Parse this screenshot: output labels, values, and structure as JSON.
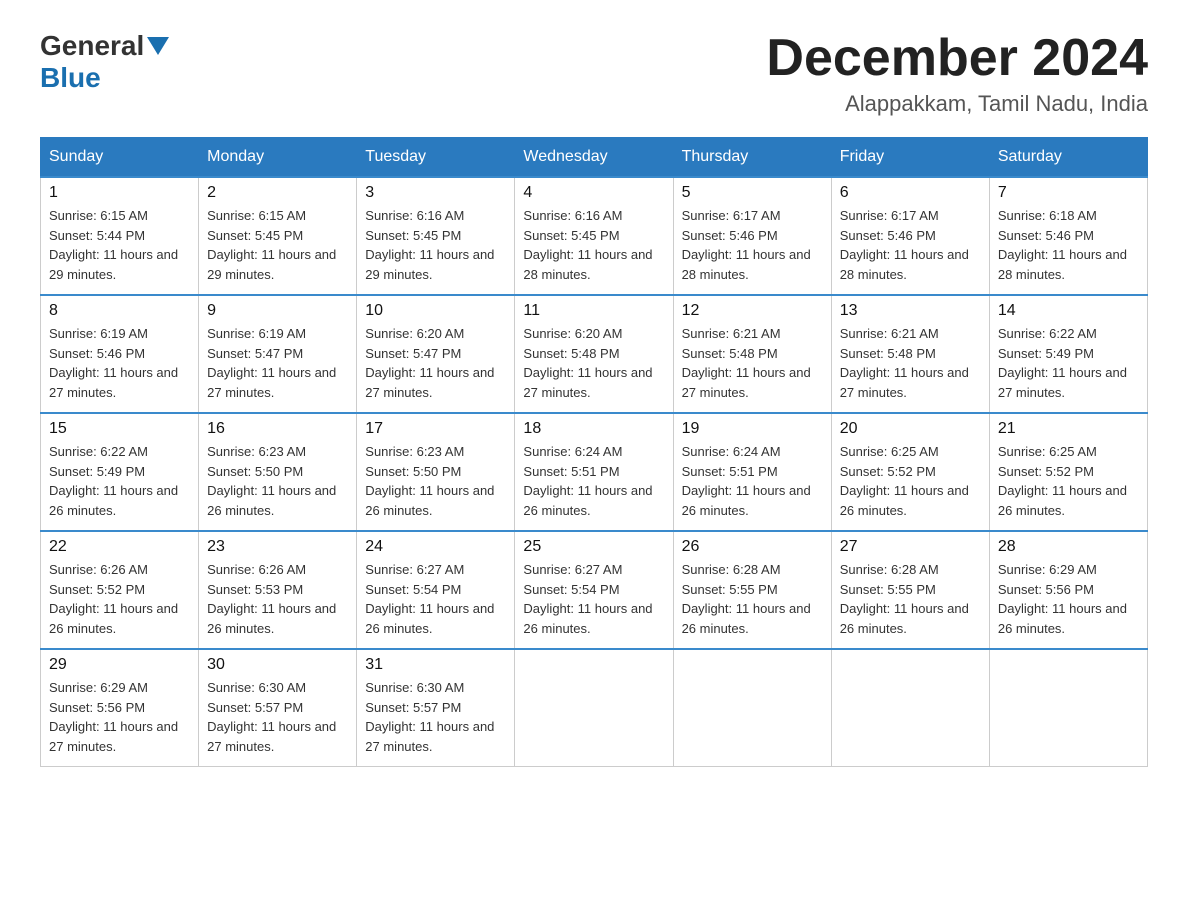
{
  "logo": {
    "general": "General",
    "blue": "Blue"
  },
  "title": "December 2024",
  "location": "Alappakkam, Tamil Nadu, India",
  "headers": [
    "Sunday",
    "Monday",
    "Tuesday",
    "Wednesday",
    "Thursday",
    "Friday",
    "Saturday"
  ],
  "weeks": [
    [
      {
        "day": "1",
        "sunrise": "6:15 AM",
        "sunset": "5:44 PM",
        "daylight": "11 hours and 29 minutes."
      },
      {
        "day": "2",
        "sunrise": "6:15 AM",
        "sunset": "5:45 PM",
        "daylight": "11 hours and 29 minutes."
      },
      {
        "day": "3",
        "sunrise": "6:16 AM",
        "sunset": "5:45 PM",
        "daylight": "11 hours and 29 minutes."
      },
      {
        "day": "4",
        "sunrise": "6:16 AM",
        "sunset": "5:45 PM",
        "daylight": "11 hours and 28 minutes."
      },
      {
        "day": "5",
        "sunrise": "6:17 AM",
        "sunset": "5:46 PM",
        "daylight": "11 hours and 28 minutes."
      },
      {
        "day": "6",
        "sunrise": "6:17 AM",
        "sunset": "5:46 PM",
        "daylight": "11 hours and 28 minutes."
      },
      {
        "day": "7",
        "sunrise": "6:18 AM",
        "sunset": "5:46 PM",
        "daylight": "11 hours and 28 minutes."
      }
    ],
    [
      {
        "day": "8",
        "sunrise": "6:19 AM",
        "sunset": "5:46 PM",
        "daylight": "11 hours and 27 minutes."
      },
      {
        "day": "9",
        "sunrise": "6:19 AM",
        "sunset": "5:47 PM",
        "daylight": "11 hours and 27 minutes."
      },
      {
        "day": "10",
        "sunrise": "6:20 AM",
        "sunset": "5:47 PM",
        "daylight": "11 hours and 27 minutes."
      },
      {
        "day": "11",
        "sunrise": "6:20 AM",
        "sunset": "5:48 PM",
        "daylight": "11 hours and 27 minutes."
      },
      {
        "day": "12",
        "sunrise": "6:21 AM",
        "sunset": "5:48 PM",
        "daylight": "11 hours and 27 minutes."
      },
      {
        "day": "13",
        "sunrise": "6:21 AM",
        "sunset": "5:48 PM",
        "daylight": "11 hours and 27 minutes."
      },
      {
        "day": "14",
        "sunrise": "6:22 AM",
        "sunset": "5:49 PM",
        "daylight": "11 hours and 27 minutes."
      }
    ],
    [
      {
        "day": "15",
        "sunrise": "6:22 AM",
        "sunset": "5:49 PM",
        "daylight": "11 hours and 26 minutes."
      },
      {
        "day": "16",
        "sunrise": "6:23 AM",
        "sunset": "5:50 PM",
        "daylight": "11 hours and 26 minutes."
      },
      {
        "day": "17",
        "sunrise": "6:23 AM",
        "sunset": "5:50 PM",
        "daylight": "11 hours and 26 minutes."
      },
      {
        "day": "18",
        "sunrise": "6:24 AM",
        "sunset": "5:51 PM",
        "daylight": "11 hours and 26 minutes."
      },
      {
        "day": "19",
        "sunrise": "6:24 AM",
        "sunset": "5:51 PM",
        "daylight": "11 hours and 26 minutes."
      },
      {
        "day": "20",
        "sunrise": "6:25 AM",
        "sunset": "5:52 PM",
        "daylight": "11 hours and 26 minutes."
      },
      {
        "day": "21",
        "sunrise": "6:25 AM",
        "sunset": "5:52 PM",
        "daylight": "11 hours and 26 minutes."
      }
    ],
    [
      {
        "day": "22",
        "sunrise": "6:26 AM",
        "sunset": "5:52 PM",
        "daylight": "11 hours and 26 minutes."
      },
      {
        "day": "23",
        "sunrise": "6:26 AM",
        "sunset": "5:53 PM",
        "daylight": "11 hours and 26 minutes."
      },
      {
        "day": "24",
        "sunrise": "6:27 AM",
        "sunset": "5:54 PM",
        "daylight": "11 hours and 26 minutes."
      },
      {
        "day": "25",
        "sunrise": "6:27 AM",
        "sunset": "5:54 PM",
        "daylight": "11 hours and 26 minutes."
      },
      {
        "day": "26",
        "sunrise": "6:28 AM",
        "sunset": "5:55 PM",
        "daylight": "11 hours and 26 minutes."
      },
      {
        "day": "27",
        "sunrise": "6:28 AM",
        "sunset": "5:55 PM",
        "daylight": "11 hours and 26 minutes."
      },
      {
        "day": "28",
        "sunrise": "6:29 AM",
        "sunset": "5:56 PM",
        "daylight": "11 hours and 26 minutes."
      }
    ],
    [
      {
        "day": "29",
        "sunrise": "6:29 AM",
        "sunset": "5:56 PM",
        "daylight": "11 hours and 27 minutes."
      },
      {
        "day": "30",
        "sunrise": "6:30 AM",
        "sunset": "5:57 PM",
        "daylight": "11 hours and 27 minutes."
      },
      {
        "day": "31",
        "sunrise": "6:30 AM",
        "sunset": "5:57 PM",
        "daylight": "11 hours and 27 minutes."
      },
      null,
      null,
      null,
      null
    ]
  ],
  "labels": {
    "sunrise_prefix": "Sunrise: ",
    "sunset_prefix": "Sunset: ",
    "daylight_prefix": "Daylight: "
  }
}
